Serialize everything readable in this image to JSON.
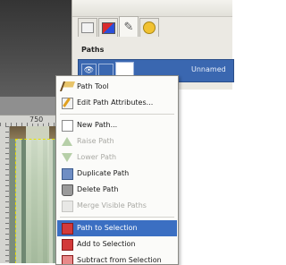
{
  "dock": {
    "panel_title": "Paths",
    "path_name": "Unnamed",
    "tabs": [
      {
        "name": "layers-tab-icon"
      },
      {
        "name": "channels-tab-icon"
      },
      {
        "name": "paths-tab-icon"
      },
      {
        "name": "undo-history-tab-icon"
      }
    ]
  },
  "canvas": {
    "ruler_label": "750"
  },
  "menu": {
    "items": [
      {
        "label": "Path Tool",
        "icon": "path-tool-icon",
        "enabled": true
      },
      {
        "label": "Edit Path Attributes...",
        "icon": "edit-attributes-icon",
        "enabled": true
      },
      {
        "label": "New Path...",
        "icon": "new-path-icon",
        "enabled": true
      },
      {
        "label": "Raise Path",
        "icon": "raise-path-icon",
        "enabled": false
      },
      {
        "label": "Lower Path",
        "icon": "lower-path-icon",
        "enabled": false
      },
      {
        "label": "Duplicate Path",
        "icon": "duplicate-path-icon",
        "enabled": true
      },
      {
        "label": "Delete Path",
        "icon": "delete-path-icon",
        "enabled": true
      },
      {
        "label": "Merge Visible Paths",
        "icon": "merge-visible-icon",
        "enabled": false
      },
      {
        "label": "Path to Selection",
        "icon": "path-to-selection-icon",
        "enabled": true,
        "highlighted": true
      },
      {
        "label": "Add to Selection",
        "icon": "add-to-selection-icon",
        "enabled": true
      },
      {
        "label": "Subtract from Selection",
        "icon": "subtract-from-selection-icon",
        "enabled": true
      }
    ],
    "highlight_color": "#3b6fc2"
  }
}
